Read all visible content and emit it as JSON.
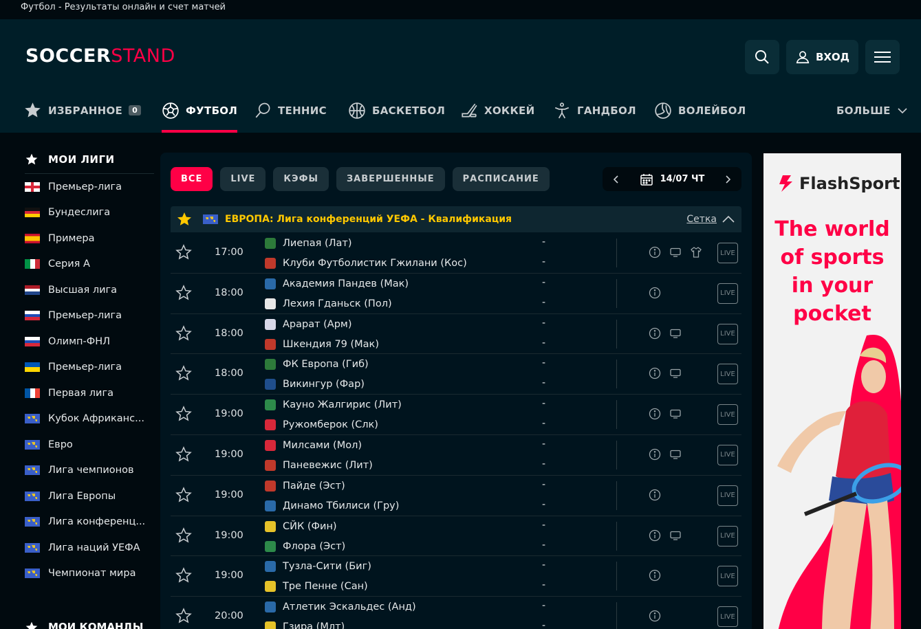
{
  "page_title": "Футбол - Результаты онлайн и счет матчей",
  "logo": {
    "part1": "SOCCER",
    "part2": "STAND"
  },
  "header": {
    "login_label": "ВХОД"
  },
  "nav": {
    "favorites_label": "ИЗБРАННОЕ",
    "favorites_count": "0",
    "items": [
      {
        "label": "ФУТБОЛ",
        "icon": "football-icon"
      },
      {
        "label": "ТЕННИС",
        "icon": "tennis-icon"
      },
      {
        "label": "БАСКЕТБОЛ",
        "icon": "basketball-icon"
      },
      {
        "label": "ХОККЕЙ",
        "icon": "hockey-icon"
      },
      {
        "label": "ГАНДБОЛ",
        "icon": "handball-icon"
      },
      {
        "label": "ВОЛЕЙБОЛ",
        "icon": "volleyball-icon"
      }
    ],
    "more_label": "БОЛЬШЕ"
  },
  "sidebar": {
    "title": "МОИ ЛИГИ",
    "items": [
      {
        "label": "Премьер-лига",
        "flag": "england"
      },
      {
        "label": "Бундеслига",
        "flag": "germany"
      },
      {
        "label": "Примера",
        "flag": "spain"
      },
      {
        "label": "Серия А",
        "flag": "italy"
      },
      {
        "label": "Высшая лига",
        "flag": "netherlands"
      },
      {
        "label": "Премьер-лига",
        "flag": "russia"
      },
      {
        "label": "Олимп-ФНЛ",
        "flag": "russia"
      },
      {
        "label": "Премьер-лига",
        "flag": "ukraine"
      },
      {
        "label": "Первая лига",
        "flag": "france"
      },
      {
        "label": "Кубок Африканс...",
        "flag": "world"
      },
      {
        "label": "Евро",
        "flag": "world"
      },
      {
        "label": "Лига чемпионов",
        "flag": "world"
      },
      {
        "label": "Лига Европы",
        "flag": "world"
      },
      {
        "label": "Лига конференц...",
        "flag": "world"
      },
      {
        "label": "Лига наций УЕФА",
        "flag": "world"
      },
      {
        "label": "Чемпионат мира",
        "flag": "world"
      }
    ],
    "teams_title": "МОИ КОМАНДЫ"
  },
  "filters": {
    "all": "ВСЕ",
    "live": "LIVE",
    "odds": "КЭФЫ",
    "finished": "ЗАВЕРШЕННЫЕ",
    "schedule": "РАСПИСАНИЕ"
  },
  "date_label": "14/07 ЧТ",
  "league": {
    "country": "ЕВРОПА:",
    "name": "Лига конференций УЕФА - Квалификация",
    "bracket_label": "Сетка"
  },
  "matches": [
    {
      "time": "17:00",
      "home": "Лиепая (Лат)",
      "away": "Клуби Футболистик Гжилани (Кос)",
      "home_score": "-",
      "away_score": "-",
      "tv": true,
      "shirt": true,
      "hc": "#2d7a3a",
      "ac": "#c0392b"
    },
    {
      "time": "18:00",
      "home": "Академия Пандев (Мак)",
      "away": "Лехия Гданьск (Пол)",
      "home_score": "-",
      "away_score": "-",
      "tv": false,
      "shirt": false,
      "hc": "#2a6aa8",
      "ac": "#e8e8e8"
    },
    {
      "time": "18:00",
      "home": "Арарат (Арм)",
      "away": "Шкендия 79 (Мак)",
      "home_score": "-",
      "away_score": "-",
      "tv": true,
      "shirt": false,
      "hc": "#d8d8e8",
      "ac": "#c0392b"
    },
    {
      "time": "18:00",
      "home": "ФК Европа (Гиб)",
      "away": "Викингур (Фар)",
      "home_score": "-",
      "away_score": "-",
      "tv": true,
      "shirt": false,
      "hc": "#2d7a3a",
      "ac": "#1f4e8c"
    },
    {
      "time": "19:00",
      "home": "Кауно Жалгирис (Лит)",
      "away": "Ружомберок (Слк)",
      "home_score": "-",
      "away_score": "-",
      "tv": true,
      "shirt": false,
      "hc": "#2d8a4a",
      "ac": "#d8283a"
    },
    {
      "time": "19:00",
      "home": "Милсами (Мол)",
      "away": "Паневежис (Лит)",
      "home_score": "-",
      "away_score": "-",
      "tv": true,
      "shirt": false,
      "hc": "#d8283a",
      "ac": "#c0392b"
    },
    {
      "time": "19:00",
      "home": "Пайде (Эст)",
      "away": "Динамо Тбилиси (Гру)",
      "home_score": "-",
      "away_score": "-",
      "tv": false,
      "shirt": false,
      "hc": "#c0392b",
      "ac": "#2a6aa8"
    },
    {
      "time": "19:00",
      "home": "СЙК (Фин)",
      "away": "Флора (Эст)",
      "home_score": "-",
      "away_score": "-",
      "tv": true,
      "shirt": false,
      "hc": "#e6c229",
      "ac": "#2d8a4a"
    },
    {
      "time": "19:00",
      "home": "Тузла-Сити (Биг)",
      "away": "Тре Пенне (Сан)",
      "home_score": "-",
      "away_score": "-",
      "tv": false,
      "shirt": false,
      "hc": "#2a6aa8",
      "ac": "#e6c229"
    },
    {
      "time": "20:00",
      "home": "Атлетик Эскальдес (Анд)",
      "away": "Гзира (Млт)",
      "home_score": "-",
      "away_score": "-",
      "tv": false,
      "shirt": false,
      "hc": "#2a6aa8",
      "ac": "#e6c229"
    }
  ],
  "live_label": "LIVE",
  "ad": {
    "brand": "FlashSport",
    "slogan_lines": [
      "The world",
      "of sports",
      "in your",
      "pocket"
    ]
  },
  "colors": {
    "accent": "#ff0046",
    "league_yellow": "#ffc800",
    "header_bg": "#001e28"
  }
}
